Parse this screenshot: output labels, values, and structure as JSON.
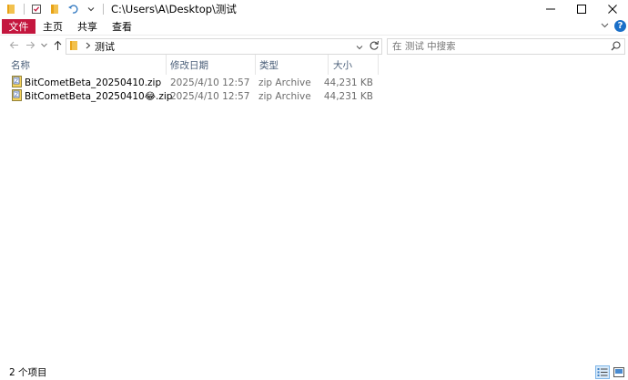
{
  "window": {
    "path_title": "C:\\Users\\A\\Desktop\\测试"
  },
  "ribbon": {
    "tabs": [
      {
        "label": "文件"
      },
      {
        "label": "主页"
      },
      {
        "label": "共享"
      },
      {
        "label": "查看"
      }
    ]
  },
  "address": {
    "crumb": "测试",
    "refresh_icon": "refresh-icon"
  },
  "search": {
    "placeholder": "在 测试 中搜索"
  },
  "columns": {
    "name": "名称",
    "date": "修改日期",
    "type": "类型",
    "size": "大小"
  },
  "files": [
    {
      "name": "BitCometBeta_20250410.zip",
      "date": "2025/4/10 12:57",
      "type": "zip Archive",
      "size": "44,231 KB"
    },
    {
      "name": "BitCometBeta_20250410😂.zip",
      "date": "2025/4/10 12:57",
      "type": "zip Archive",
      "size": "44,231 KB"
    }
  ],
  "status": {
    "item_count": "2 个项目"
  },
  "colors": {
    "file_tab": "#c4163e",
    "help": "#1a6fc8",
    "column_header_text": "#4c607a",
    "folder": "#f2c14e"
  }
}
